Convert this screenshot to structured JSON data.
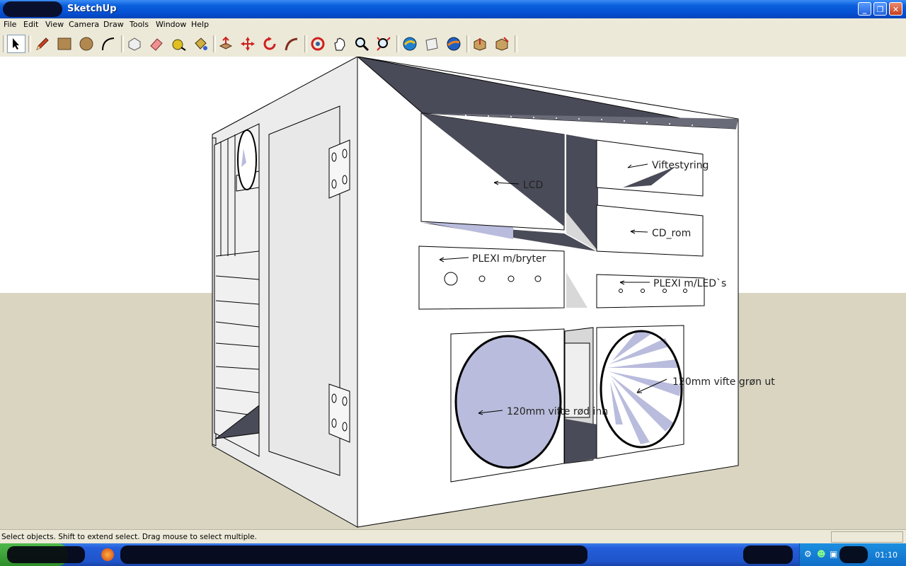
{
  "window": {
    "title": "SketchUp"
  },
  "menu": [
    "File",
    "Edit",
    "View",
    "Camera",
    "Draw",
    "Tools",
    "Window",
    "Help"
  ],
  "toolbar": {
    "tools": [
      "select-icon",
      "pencil-icon",
      "rectangle-icon",
      "circle-icon",
      "arc-icon",
      "make-component-icon",
      "eraser-icon",
      "tape-measure-icon",
      "paint-bucket-icon",
      "push-pull-icon",
      "move-icon",
      "rotate-icon",
      "follow-me-icon",
      "orbit-icon",
      "pan-icon",
      "zoom-icon",
      "zoom-extents-icon",
      "get-models-icon",
      "share-model-icon",
      "google-earth-icon",
      "import-model-icon",
      "export-model-icon"
    ]
  },
  "model": {
    "labels": {
      "lcd": "LCD",
      "viftestyring": "Viftestyring",
      "cd_rom": "CD_rom",
      "plexi_bryter": "PLEXI m/bryter",
      "plexi_led": "PLEXI m/LED`s",
      "fan_in": "120mm vifte rød inn",
      "fan_out": "120mm vifte grøn ut"
    },
    "colors": {
      "sky": "#ffffff",
      "ground": "#d8d4c0",
      "fan": "#b9bcdc",
      "shadow": "#4a4b58"
    }
  },
  "status": {
    "hint": "Select objects. Shift to extend select. Drag mouse to select multiple."
  },
  "taskbar": {
    "clock": "01:10"
  }
}
